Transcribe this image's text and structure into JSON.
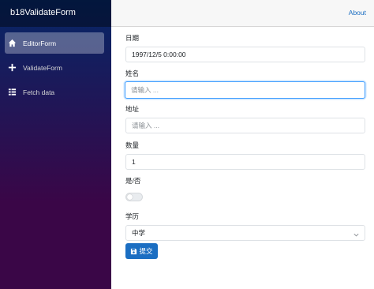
{
  "sidebar": {
    "brand": "b18ValidateForm",
    "items": [
      {
        "label": "EditorForm",
        "icon": "home-icon",
        "active": true
      },
      {
        "label": "ValidateForm",
        "icon": "plus-icon",
        "active": false
      },
      {
        "label": "Fetch data",
        "icon": "list-icon",
        "active": false
      }
    ]
  },
  "topbar": {
    "about": "About"
  },
  "form": {
    "date": {
      "label": "日期",
      "value": "1997/12/5 0:00:00"
    },
    "name": {
      "label": "姓名",
      "placeholder": "请输入 ..."
    },
    "address": {
      "label": "地址",
      "placeholder": "请输入 ..."
    },
    "quantity": {
      "label": "数量",
      "value": "1"
    },
    "yesno": {
      "label": "是/否",
      "checked": false
    },
    "education": {
      "label": "学历",
      "selected": "中学"
    },
    "submit": {
      "label": "提交",
      "icon": "save-icon"
    }
  },
  "colors": {
    "primary": "#1b6ec2",
    "sidebar_top": "#052767",
    "sidebar_bottom": "#3a0647",
    "focus": "#409eff"
  }
}
